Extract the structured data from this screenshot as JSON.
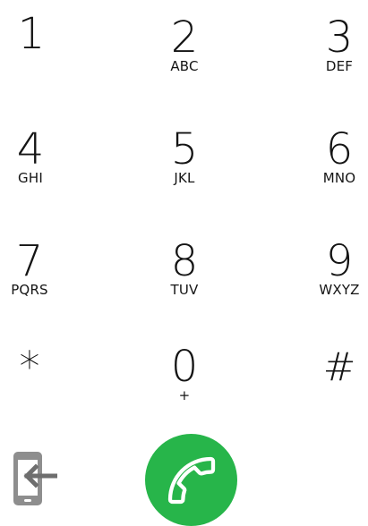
{
  "dialpad": {
    "keys": [
      {
        "digit": "1",
        "letters": ""
      },
      {
        "digit": "2",
        "letters": "ABC"
      },
      {
        "digit": "3",
        "letters": "DEF"
      },
      {
        "digit": "4",
        "letters": "GHI"
      },
      {
        "digit": "5",
        "letters": "JKL"
      },
      {
        "digit": "6",
        "letters": "MNO"
      },
      {
        "digit": "7",
        "letters": "PQRS"
      },
      {
        "digit": "8",
        "letters": "TUV"
      },
      {
        "digit": "9",
        "letters": "WXYZ"
      },
      {
        "digit": "*",
        "letters": ""
      },
      {
        "digit": "0",
        "letters": "+"
      },
      {
        "digit": "#",
        "letters": ""
      }
    ]
  },
  "actions": {
    "call_icon": "phone-handset-icon",
    "call_color": "#27b54a",
    "transfer_icon": "phone-transfer-icon"
  }
}
